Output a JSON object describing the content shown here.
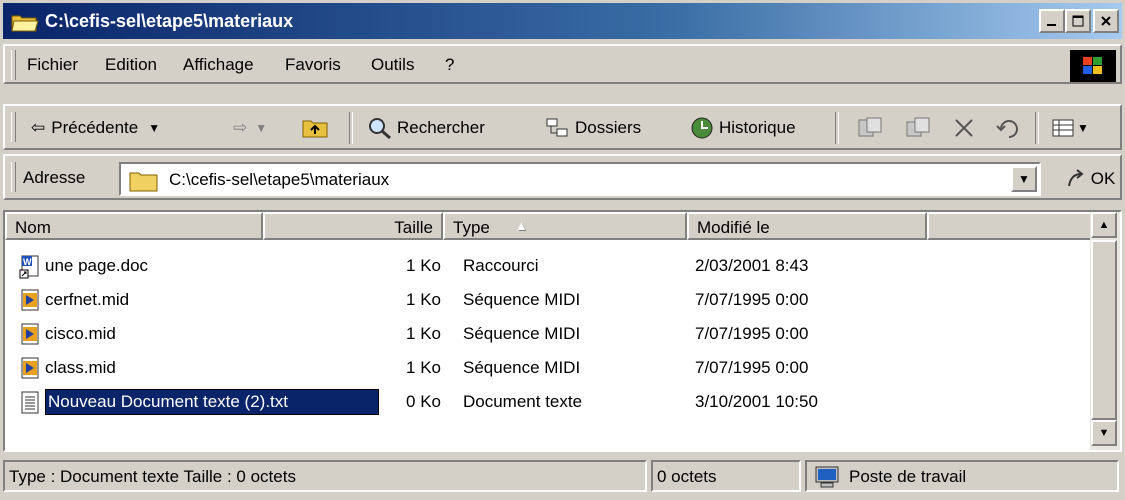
{
  "window": {
    "title": "C:\\cefis-sel\\etape5\\materiaux"
  },
  "menu": {
    "items": [
      {
        "label": "Fichier"
      },
      {
        "label": "Edition"
      },
      {
        "label": "Affichage"
      },
      {
        "label": "Favoris"
      },
      {
        "label": "Outils"
      },
      {
        "label": "?"
      }
    ]
  },
  "toolbar": {
    "back_label": "Précédente",
    "search_label": "Rechercher",
    "folders_label": "Dossiers",
    "history_label": "Historique"
  },
  "address": {
    "label": "Adresse",
    "value": "C:\\cefis-sel\\etape5\\materiaux",
    "go_label": "OK"
  },
  "list": {
    "columns": [
      {
        "label": "Nom"
      },
      {
        "label": "Taille"
      },
      {
        "label": "Type"
      },
      {
        "label": "Modifié le"
      }
    ],
    "rows": [
      {
        "name": "une page.doc",
        "size": "1 Ko",
        "type": "Raccourci",
        "modified": "2/03/2001 8:43",
        "icon": "word-shortcut-icon"
      },
      {
        "name": "cerfnet.mid",
        "size": "1 Ko",
        "type": "Séquence MIDI",
        "modified": "7/07/1995 0:00",
        "icon": "midi-file-icon"
      },
      {
        "name": "cisco.mid",
        "size": "1 Ko",
        "type": "Séquence MIDI",
        "modified": "7/07/1995 0:00",
        "icon": "midi-file-icon"
      },
      {
        "name": "class.mid",
        "size": "1 Ko",
        "type": "Séquence MIDI",
        "modified": "7/07/1995 0:00",
        "icon": "midi-file-icon"
      },
      {
        "name": "Nouveau Document texte (2).txt",
        "size": "0 Ko",
        "type": "Document texte",
        "modified": "3/10/2001 10:50",
        "icon": "text-file-icon",
        "renaming": true
      }
    ]
  },
  "status": {
    "info": "Type : Document texte Taille : 0 octets",
    "size": "0 octets",
    "zone": "Poste de travail"
  },
  "colors": {
    "title_start": "#0a246a",
    "title_end": "#a6caf0",
    "face": "#d4d0c8",
    "selection": "#0a246a"
  }
}
